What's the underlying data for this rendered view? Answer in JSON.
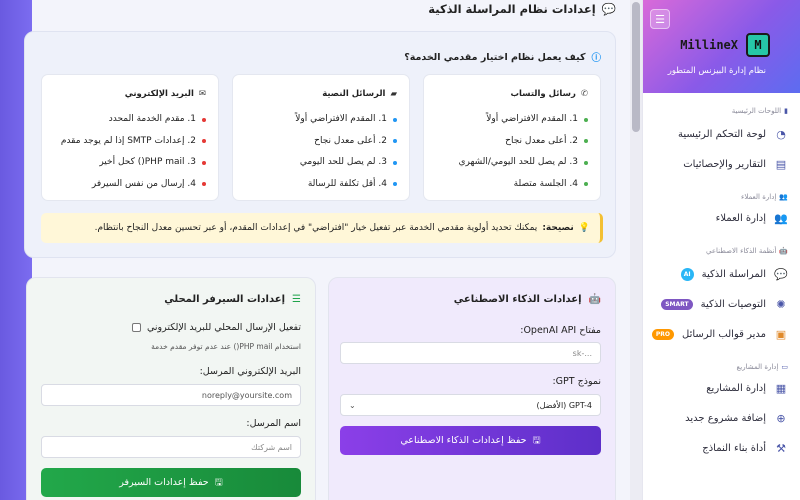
{
  "sidebar": {
    "menu_icon": "☰",
    "logo_letter": "M",
    "brand": "MillineX",
    "tagline": "نظام إدارة البيزنس المتطور",
    "sections": [
      {
        "title": "اللوحات الرئيسية",
        "icon": "chart-bars-icon"
      },
      {
        "title": "إدارة العملاء",
        "icon": "users-icon"
      },
      {
        "title": "أنظمة الذكاء الاصطناعي",
        "icon": "robot-icon"
      },
      {
        "title": "إدارة المشاريع",
        "icon": "briefcase-icon"
      }
    ],
    "items": [
      {
        "label": "لوحة التحكم الرئيسية",
        "icon": "dashboard-icon"
      },
      {
        "label": "التقارير والإحصائيات",
        "icon": "chart-icon"
      },
      {
        "label": "إدارة العملاء",
        "icon": "users-icon"
      },
      {
        "label": "المراسلة الذكية",
        "icon": "chat-icon",
        "badge": "AI"
      },
      {
        "label": "التوصيات الذكية",
        "icon": "brain-icon",
        "badge": "SMART"
      },
      {
        "label": "مدير قوالب الرسائل",
        "icon": "template-icon",
        "badge": "PRO"
      },
      {
        "label": "إدارة المشاريع",
        "icon": "project-icon"
      },
      {
        "label": "إضافة مشروع جديد",
        "icon": "plus-circle-icon"
      },
      {
        "label": "أداة بناء النماذج",
        "icon": "form-builder-icon"
      }
    ]
  },
  "page": {
    "title": "إعدادات نظام المراسلة الذكية"
  },
  "info": {
    "question": "كيف يعمل نظام اختيار مقدمي الخدمة؟",
    "columns": [
      {
        "title": "رسائل والتساب",
        "color": "#4caf50",
        "items": [
          "1. المقدم الافتراضي أولاً",
          "2. أعلى معدل نجاح",
          "3. لم يصل للحد اليومي/الشهري",
          "4. الجلسة متصلة"
        ]
      },
      {
        "title": "الرسائل النصية",
        "color": "#2196f3",
        "items": [
          "1. المقدم الافتراضي أولاً",
          "2. أعلى معدل نجاح",
          "3. لم يصل للحد اليومي",
          "4. أقل تكلفة للرسالة"
        ]
      },
      {
        "title": "البريد الإلكتروني",
        "color": "#e53935",
        "items": [
          "1. مقدم الخدمة المحدد",
          "2. إعدادات SMTP إذا لم يوجد مقدم",
          "3. PHP mail() كحل أخير",
          "4. إرسال من نفس السيرفر"
        ]
      }
    ],
    "tip_label": "نصيحة:",
    "tip_text": "يمكنك تحديد أولوية مقدمي الخدمة عبر تفعيل خيار \"افتراضي\" في إعدادات المقدم، أو عبر تحسين معدل النجاح بانتظام."
  },
  "ai": {
    "title": "إعدادات الذكاء الاصطناعي",
    "key_label": "مفتاح OpenAI API:",
    "key_placeholder": "sk-...",
    "model_label": "نموذج GPT:",
    "model_value": "GPT-4 (الأفضل)",
    "save_label": "حفظ إعدادات الذكاء الاصطناعي"
  },
  "server": {
    "title": "إعدادات السيرفر المحلي",
    "local_email_label": "تفعيل الإرسال المحلي للبريد الإلكتروني",
    "local_email_hint": "استخدام PHP mail() عند عدم توفر مقدم خدمة",
    "sender_email_label": "البريد الإلكتروني المرسل:",
    "sender_email_value": "noreply@yoursite.com",
    "sender_name_label": "اسم المرسل:",
    "sender_name_placeholder": "اسم شركتك",
    "save_label": "حفظ إعدادات السيرفر"
  },
  "colors": {
    "accent": "#7b3fe4",
    "server_button": "#1fa34a",
    "tip_border": "#f3c033"
  }
}
